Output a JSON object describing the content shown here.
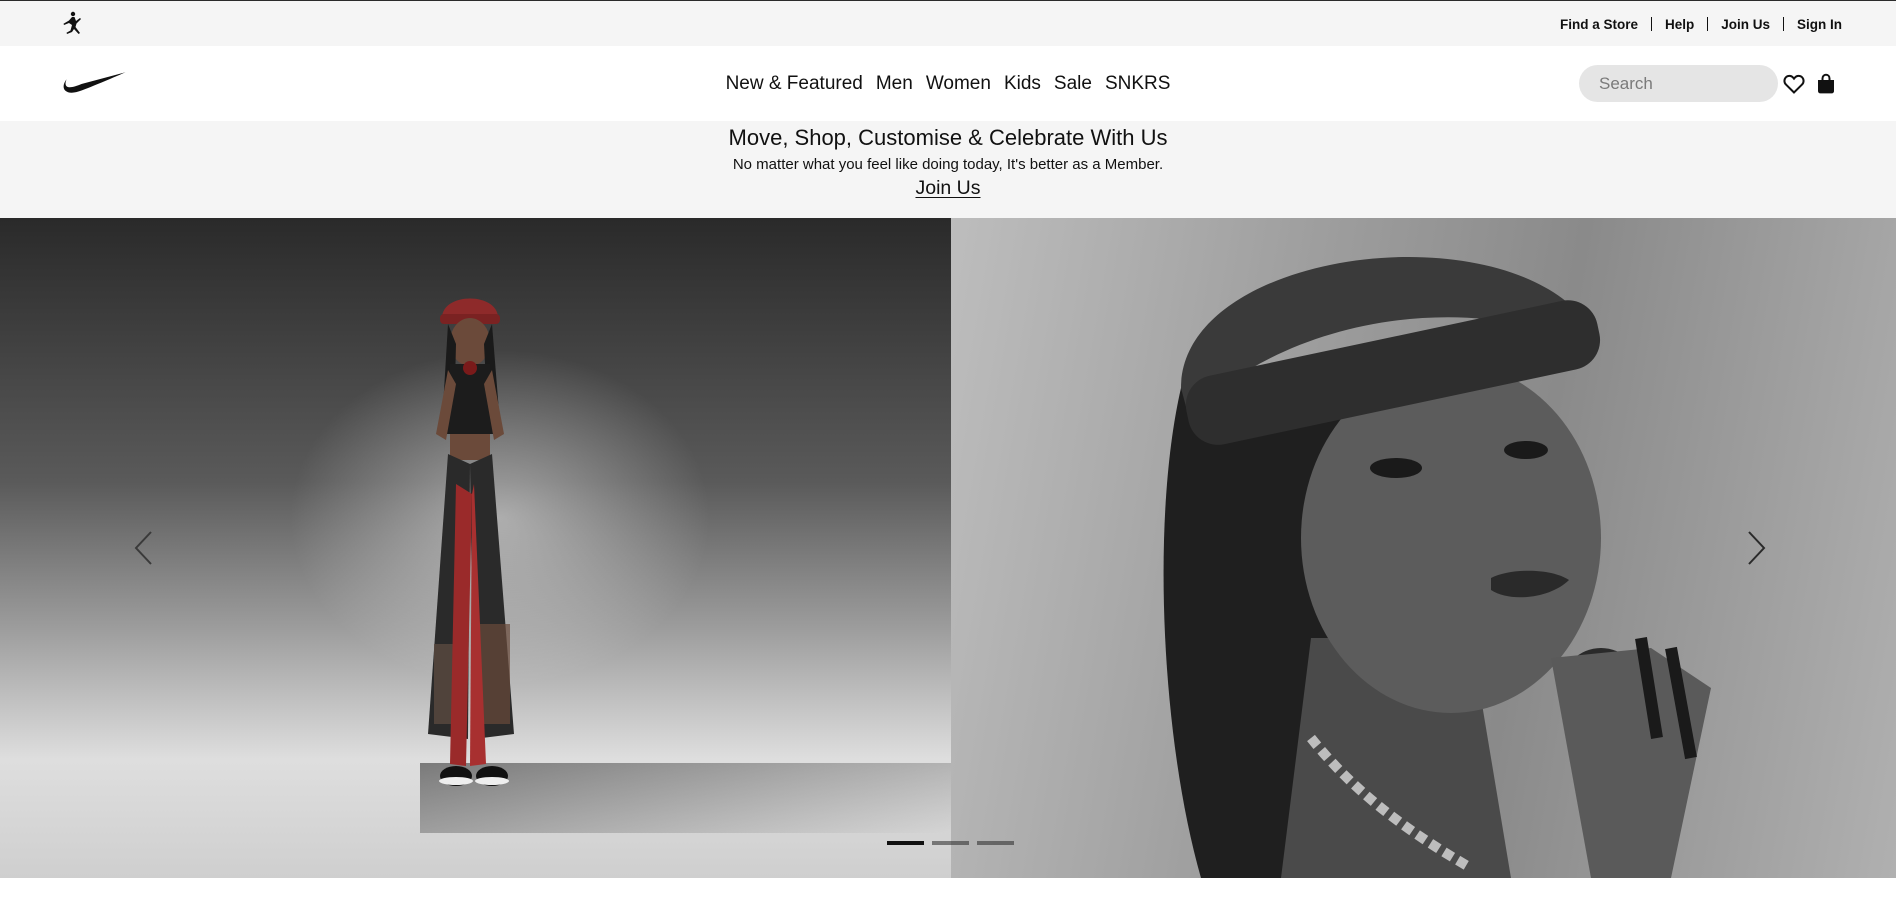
{
  "utility_bar": {
    "links": {
      "find_store": "Find a Store",
      "help": "Help",
      "join_us": "Join Us",
      "sign_in": "Sign In"
    },
    "logo_icon": "jordan-jumpman-icon"
  },
  "nav": {
    "logo_icon": "nike-swoosh-icon",
    "items": [
      "New & Featured",
      "Men",
      "Women",
      "Kids",
      "Sale",
      "SNKRS"
    ],
    "search": {
      "placeholder": "Search",
      "value": ""
    },
    "icons": [
      "heart-icon",
      "shopping-bag-icon"
    ]
  },
  "member_banner": {
    "title": "Move, Shop, Customise & Celebrate With Us",
    "subtitle": "No matter what you feel like doing today, It's better as a Member.",
    "link": "Join Us"
  },
  "hero": {
    "slide_count": 3,
    "active_slide": 1,
    "arrows": [
      "chevron-left-icon",
      "chevron-right-icon"
    ]
  },
  "colors": {
    "utility_bg": "#f5f5f5",
    "search_bg": "#e5e5e5",
    "text": "#111111",
    "accent_red": "#a52a2a"
  }
}
